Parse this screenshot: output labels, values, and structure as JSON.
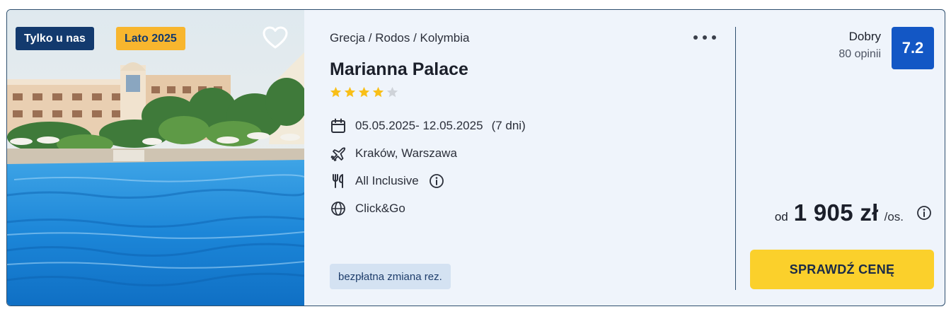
{
  "badges": {
    "exclusive": "Tylko u nas",
    "season": "Lato 2025"
  },
  "hotel": {
    "breadcrumb": "Grecja / Rodos / Kolymbia",
    "name": "Marianna Palace",
    "stars": 4,
    "max_stars": 5
  },
  "details": {
    "dates": "05.05.2025- 12.05.2025",
    "duration": "(7 dni)",
    "departure": "Kraków, Warszawa",
    "board": "All Inclusive",
    "transport": "Click&Go"
  },
  "tag": "bezpłatna zmiana rez.",
  "rating": {
    "label": "Dobry",
    "count": "80 opinii",
    "score": "7.2"
  },
  "price": {
    "prefix": "od",
    "amount": "1 905 zł",
    "suffix": "/os."
  },
  "cta_label": "SPRAWDŹ CENĘ",
  "icons": {
    "favorite": "heart-icon",
    "more": "more-dots-icon",
    "star": "star-icon",
    "calendar": "calendar-icon",
    "plane": "plane-icon",
    "board": "fork-knife-icon",
    "info": "info-icon",
    "globe": "globe-icon"
  },
  "colors": {
    "card_bg": "#eff4fb",
    "badge_dark": "#133a6e",
    "badge_accent": "#f8b62e",
    "star": "#f9bf17",
    "star_empty": "#cfd3d9",
    "rating_bg": "#1357c5",
    "cta_bg": "#fbd02b",
    "tag_bg": "#d4e2f2"
  }
}
